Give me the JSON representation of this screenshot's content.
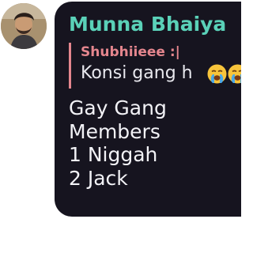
{
  "sender": {
    "name": "Munna Bhaiya",
    "color": "#5ad1b8"
  },
  "quoted_reply": {
    "author": "Shubhiieee :|",
    "text": "Konsi gang h",
    "emojis": [
      "loudly-crying-face-icon",
      "loudly-crying-face-icon"
    ],
    "accent_color": "#e5868e"
  },
  "message": {
    "lines": [
      "Gay Gang",
      "Members",
      "1 Niggah",
      "2 Jack"
    ]
  },
  "colors": {
    "bubble_background": "#16141f",
    "message_text": "#f2f2f6"
  }
}
